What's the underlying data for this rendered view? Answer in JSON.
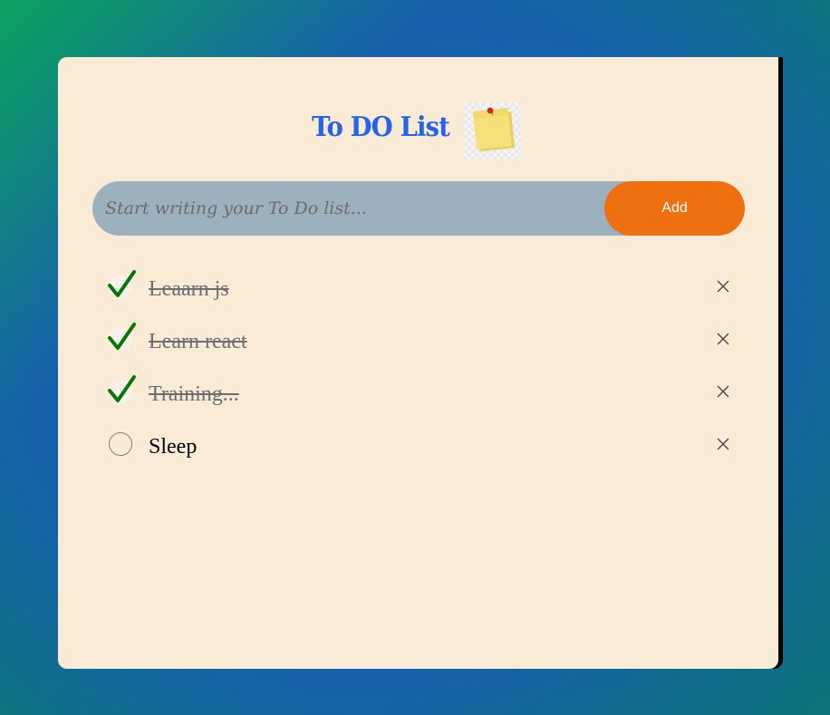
{
  "header": {
    "title": "To DO List",
    "icon": "sticky-notes-icon"
  },
  "input": {
    "placeholder": "Start writing your To Do list...",
    "value": ""
  },
  "add_button": {
    "label": "Add"
  },
  "tasks": [
    {
      "label": "Leaarn js",
      "done": true
    },
    {
      "label": "Learn react",
      "done": true
    },
    {
      "label": "Training...",
      "done": true
    },
    {
      "label": "Sleep",
      "done": false
    }
  ],
  "colors": {
    "card": "#faebd7",
    "title": "#2563eb",
    "input_bg": "#9db0be",
    "add_button": "#ee7011",
    "check": "#067806",
    "background": "#1760ab"
  }
}
